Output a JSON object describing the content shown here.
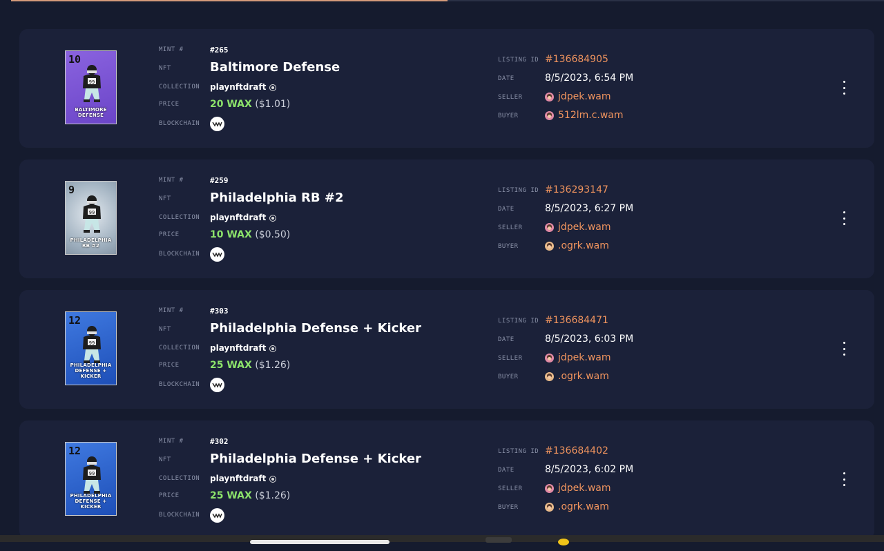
{
  "page": {
    "progress_fraction": 0.5
  },
  "labels": {
    "mint": "MINT #",
    "nft": "NFT",
    "collection": "COLLECTION",
    "price": "PRICE",
    "blockchain": "BLOCKCHAIN",
    "listing_id": "LISTING ID",
    "date": "DATE",
    "seller": "SELLER",
    "buyer": "BUYER"
  },
  "sales": [
    {
      "mint": "#265",
      "name": "Baltimore Defense",
      "collection": "playnftdraft",
      "price_wax": "20 WAX",
      "price_usd": "($1.01)",
      "listing_id": "#136684905",
      "date": "8/5/2023, 6:54 PM",
      "seller": "jdpek.wam",
      "buyer": "512lm.c.wam",
      "card_number": "10",
      "card_caption": "BALTIMORE DEFENSE",
      "card_style": "purple"
    },
    {
      "mint": "#259",
      "name": "Philadelphia RB #2",
      "collection": "playnftdraft",
      "price_wax": "10 WAX",
      "price_usd": "($0.50)",
      "listing_id": "#136293147",
      "date": "8/5/2023, 6:27 PM",
      "seller": "jdpek.wam",
      "buyer": ".ogrk.wam",
      "card_number": "9",
      "card_caption": "PHILADELPHIA RB #2",
      "card_style": "grey"
    },
    {
      "mint": "#303",
      "name": "Philadelphia Defense + Kicker",
      "collection": "playnftdraft",
      "price_wax": "25 WAX",
      "price_usd": "($1.26)",
      "listing_id": "#136684471",
      "date": "8/5/2023, 6:03 PM",
      "seller": "jdpek.wam",
      "buyer": ".ogrk.wam",
      "card_number": "12",
      "card_caption": "PHILADELPHIA DEFENSE + KICKER",
      "card_style": "blue"
    },
    {
      "mint": "#302",
      "name": "Philadelphia Defense + Kicker",
      "collection": "playnftdraft",
      "price_wax": "25 WAX",
      "price_usd": "($1.26)",
      "listing_id": "#136684402",
      "date": "8/5/2023, 6:02 PM",
      "seller": "jdpek.wam",
      "buyer": ".ogrk.wam",
      "card_number": "12",
      "card_caption": "PHILADELPHIA DEFENSE + KICKER",
      "card_style": "blue"
    }
  ],
  "icons": {
    "blockchain": "wax-logo-icon",
    "menu": "more-vertical-icon",
    "verified": "verified-icon",
    "avatar": "user-avatar-icon"
  },
  "colors": {
    "background": "#151b2e",
    "card": "#1b2139",
    "accent_orange": "#f0945e",
    "wax_green": "#8ce36b"
  }
}
